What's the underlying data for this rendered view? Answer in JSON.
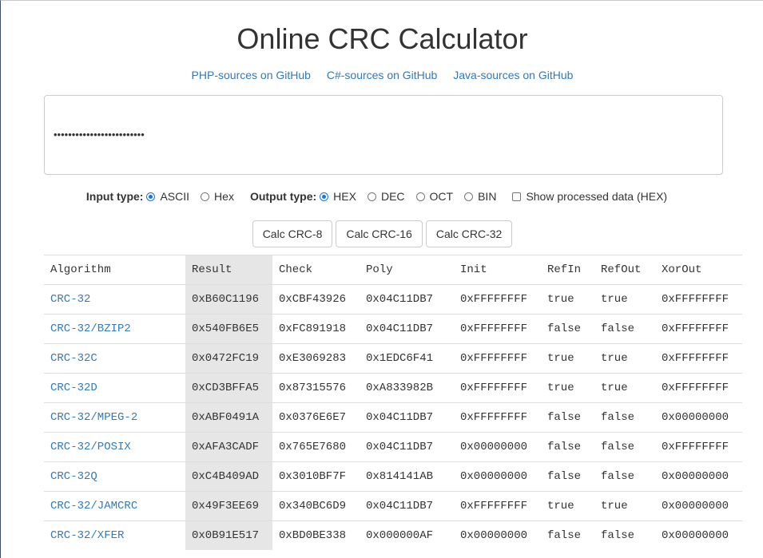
{
  "page": {
    "title": "Online CRC Calculator"
  },
  "links": [
    {
      "label": "PHP-sources on GitHub"
    },
    {
      "label": "C#-sources on GitHub"
    },
    {
      "label": "Java-sources on GitHub"
    }
  ],
  "input": {
    "value": "•••••••••••••••••••••••••"
  },
  "options": {
    "input_type_label": "Input type:",
    "input_types": [
      {
        "label": "ASCII",
        "checked": true
      },
      {
        "label": "Hex",
        "checked": false
      }
    ],
    "output_type_label": "Output type:",
    "output_types": [
      {
        "label": "HEX",
        "checked": true
      },
      {
        "label": "DEC",
        "checked": false
      },
      {
        "label": "OCT",
        "checked": false
      },
      {
        "label": "BIN",
        "checked": false
      }
    ],
    "show_processed_label": "Show processed data (HEX)",
    "show_processed_checked": false
  },
  "buttons": {
    "crc8": "Calc CRC-8",
    "crc16": "Calc CRC-16",
    "crc32": "Calc CRC-32"
  },
  "table": {
    "headers": [
      "Algorithm",
      "Result",
      "Check",
      "Poly",
      "Init",
      "RefIn",
      "RefOut",
      "XorOut"
    ],
    "rows": [
      [
        "CRC-32",
        "0xB60C1196",
        "0xCBF43926",
        "0x04C11DB7",
        "0xFFFFFFFF",
        "true",
        "true",
        "0xFFFFFFFF"
      ],
      [
        "CRC-32/BZIP2",
        "0x540FB6E5",
        "0xFC891918",
        "0x04C11DB7",
        "0xFFFFFFFF",
        "false",
        "false",
        "0xFFFFFFFF"
      ],
      [
        "CRC-32C",
        "0x0472FC19",
        "0xE3069283",
        "0x1EDC6F41",
        "0xFFFFFFFF",
        "true",
        "true",
        "0xFFFFFFFF"
      ],
      [
        "CRC-32D",
        "0xCD3BFFA5",
        "0x87315576",
        "0xA833982B",
        "0xFFFFFFFF",
        "true",
        "true",
        "0xFFFFFFFF"
      ],
      [
        "CRC-32/MPEG-2",
        "0xABF0491A",
        "0x0376E6E7",
        "0x04C11DB7",
        "0xFFFFFFFF",
        "false",
        "false",
        "0x00000000"
      ],
      [
        "CRC-32/POSIX",
        "0xAFA3CADF",
        "0x765E7680",
        "0x04C11DB7",
        "0x00000000",
        "false",
        "false",
        "0xFFFFFFFF"
      ],
      [
        "CRC-32Q",
        "0xC4B409AD",
        "0x3010BF7F",
        "0x814141AB",
        "0x00000000",
        "false",
        "false",
        "0x00000000"
      ],
      [
        "CRC-32/JAMCRC",
        "0x49F3EE69",
        "0x340BC6D9",
        "0x04C11DB7",
        "0xFFFFFFFF",
        "true",
        "true",
        "0x00000000"
      ],
      [
        "CRC-32/XFER",
        "0x0B91E517",
        "0xBD0BE338",
        "0x000000AF",
        "0x00000000",
        "false",
        "false",
        "0x00000000"
      ]
    ]
  }
}
